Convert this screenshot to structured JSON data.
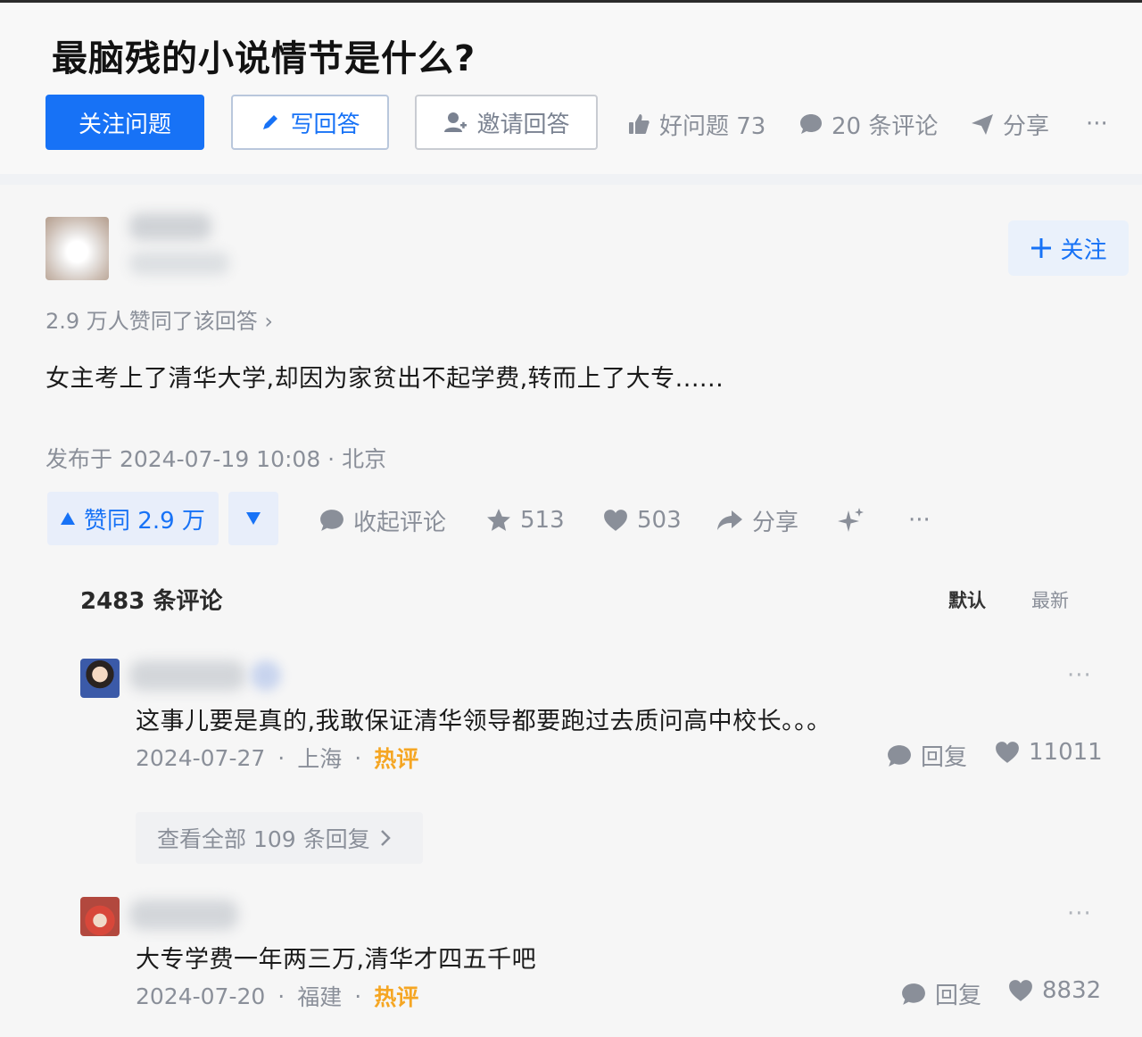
{
  "question": {
    "title": "最脑残的小说情节是什么?",
    "follow_label": "关注问题",
    "write_label": "写回答",
    "invite_label": "邀请回答",
    "good_question_label": "好问题 73",
    "comments_label": "20 条评论",
    "share_label": "分享",
    "more_label": "···"
  },
  "answer": {
    "follow_label": "关注",
    "upvote_summary": "2.9 万人赞同了该回答 ›",
    "text": "女主考上了清华大学,却因为家贫出不起学费,转而上了大专......",
    "publish_info": "发布于 2024-07-19 10:08 · 北京",
    "vote_label": "赞同 2.9 万",
    "collapse_comments_label": "收起评论",
    "favorites_count": "513",
    "likes_count": "503",
    "share_label": "分享",
    "more_label": "···"
  },
  "comments": {
    "count_label": "2483 条评论",
    "sort_default": "默认",
    "sort_latest": "最新",
    "items": [
      {
        "text": "这事儿要是真的,我敢保证清华领导都要跑过去质问高中校长。。。",
        "date": "2024-07-27",
        "location": "上海",
        "tag": "热评",
        "reply_label": "回复",
        "likes": "11011",
        "more_label": "···"
      },
      {
        "text": "大专学费一年两三万,清华才四五千吧",
        "date": "2024-07-20",
        "location": "福建",
        "tag": "热评",
        "reply_label": "回复",
        "likes": "8832",
        "more_label": "···"
      }
    ],
    "view_replies_label": "查看全部 109 条回复"
  },
  "colors": {
    "brand_blue": "#1772f6",
    "muted_text": "#8a8f99",
    "hot_tag": "#f5a623"
  }
}
